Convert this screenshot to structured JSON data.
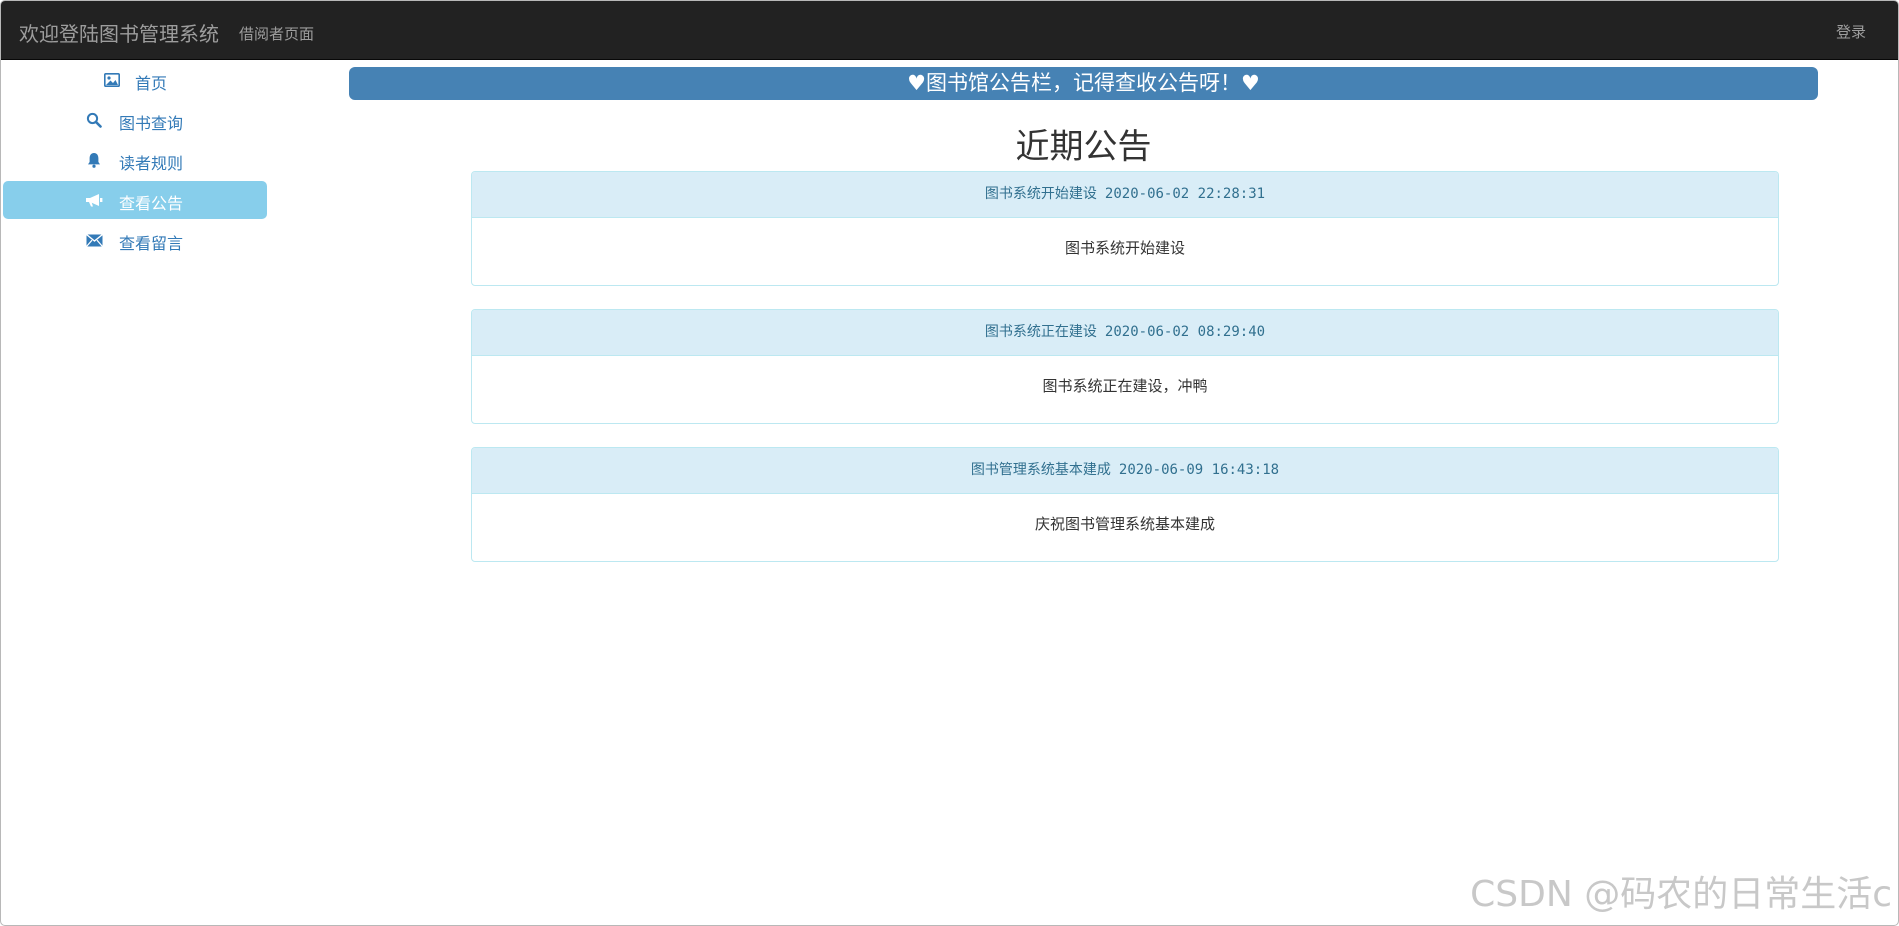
{
  "navbar": {
    "brand": "欢迎登陆图书管理系统",
    "subtitle": "借阅者页面",
    "login_label": "登录"
  },
  "sidebar": {
    "items": [
      {
        "label": "首页",
        "icon": "picture-icon"
      },
      {
        "label": "图书查询",
        "icon": "search-icon"
      },
      {
        "label": "读者规则",
        "icon": "bell-icon"
      },
      {
        "label": "查看公告",
        "icon": "bullhorn-icon",
        "active": true
      },
      {
        "label": "查看留言",
        "icon": "envelope-icon"
      }
    ]
  },
  "main": {
    "banner": "♥图书馆公告栏，记得查收公告呀！♥",
    "title": "近期公告",
    "notices": [
      {
        "title": "图书系统开始建设",
        "time": "2020-06-02 22:28:31",
        "content": "图书系统开始建设"
      },
      {
        "title": "图书系统正在建设",
        "time": "2020-06-02 08:29:40",
        "content": "图书系统正在建设，冲鸭"
      },
      {
        "title": "图书管理系统基本建成",
        "time": "2020-06-09 16:43:18",
        "content": "庆祝图书管理系统基本建成"
      }
    ]
  },
  "watermark": "CSDN @码农的日常生活c",
  "colors": {
    "navbar": "#222222",
    "link": "#337ab7",
    "active_item": "#87ceeb",
    "banner": "#4682b4",
    "notice_head": "#d9edf7",
    "notice_border": "#bce8f1"
  }
}
